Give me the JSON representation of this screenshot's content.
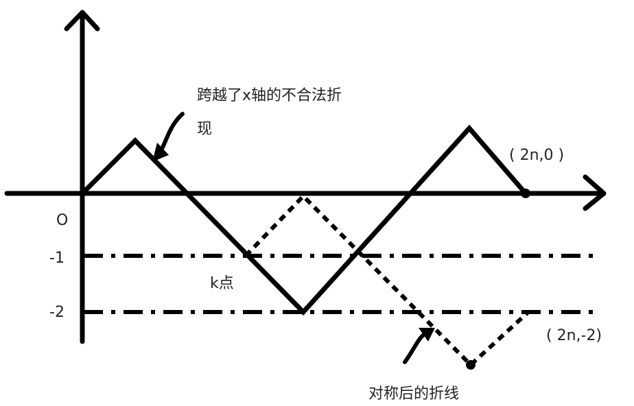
{
  "labels": {
    "origin": "O",
    "y_minus_1": "-1",
    "y_minus_2": "-2",
    "point_2n_0": "( 2n,0 )",
    "point_2n_minus_2": "( 2n,-2)",
    "k_point": "k点",
    "illegal_path_line1": "跨越了x轴的不合法折",
    "illegal_path_line2": "现",
    "reflected_path": "对称后的折线"
  },
  "colors": {
    "stroke": "#000000",
    "text": "#222222",
    "background": "#ffffff"
  }
}
